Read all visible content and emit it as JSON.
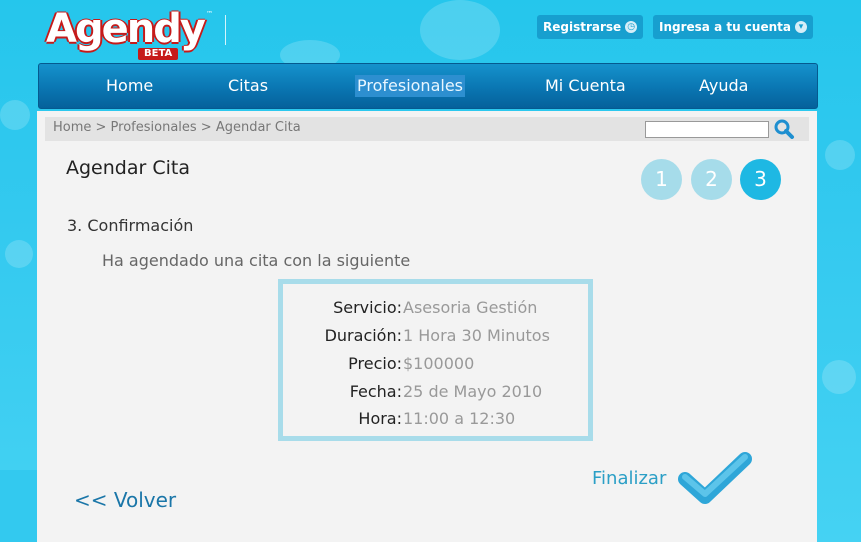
{
  "brand": {
    "name": "Agendy",
    "badge": "BETA",
    "trademark": "™"
  },
  "header": {
    "register_label": "Registrarse",
    "login_label": "Ingresa a tu cuenta"
  },
  "nav": {
    "items": [
      {
        "label": "Home"
      },
      {
        "label": "Citas"
      },
      {
        "label": "Profesionales",
        "active": true
      },
      {
        "label": "Mi Cuenta"
      },
      {
        "label": "Ayuda"
      }
    ]
  },
  "breadcrumb": {
    "text": "Home > Profesionales > Agendar Cita"
  },
  "search": {
    "value": "",
    "placeholder": ""
  },
  "page": {
    "title": "Agendar Cita",
    "steps": [
      {
        "label": "1",
        "state": "done"
      },
      {
        "label": "2",
        "state": "done"
      },
      {
        "label": "3",
        "state": "current"
      }
    ],
    "section_title": "3. Confirmación",
    "intro": "Ha agendado una cita con la siguiente"
  },
  "summary": {
    "rows": [
      {
        "label": "Servicio:",
        "value": "Asesoria Gestión"
      },
      {
        "label": "Duración:",
        "value": "1 Hora 30 Minutos"
      },
      {
        "label": "Precio:",
        "value": "$100000"
      },
      {
        "label": "Fecha:",
        "value": "25 de Mayo 2010"
      },
      {
        "label": "Hora:",
        "value": "11:00 a 12:30"
      }
    ]
  },
  "actions": {
    "back_label": "<< Volver",
    "finish_label": "Finalizar"
  },
  "colors": {
    "background": "#33c9ef",
    "nav": "#0a76b2",
    "accent": "#1eb8e3",
    "step_done": "#a6dcea",
    "link": "#1a76a8"
  },
  "icons": [
    "search-icon",
    "checkmark-icon",
    "clock-icon",
    "chevron-down-icon"
  ]
}
